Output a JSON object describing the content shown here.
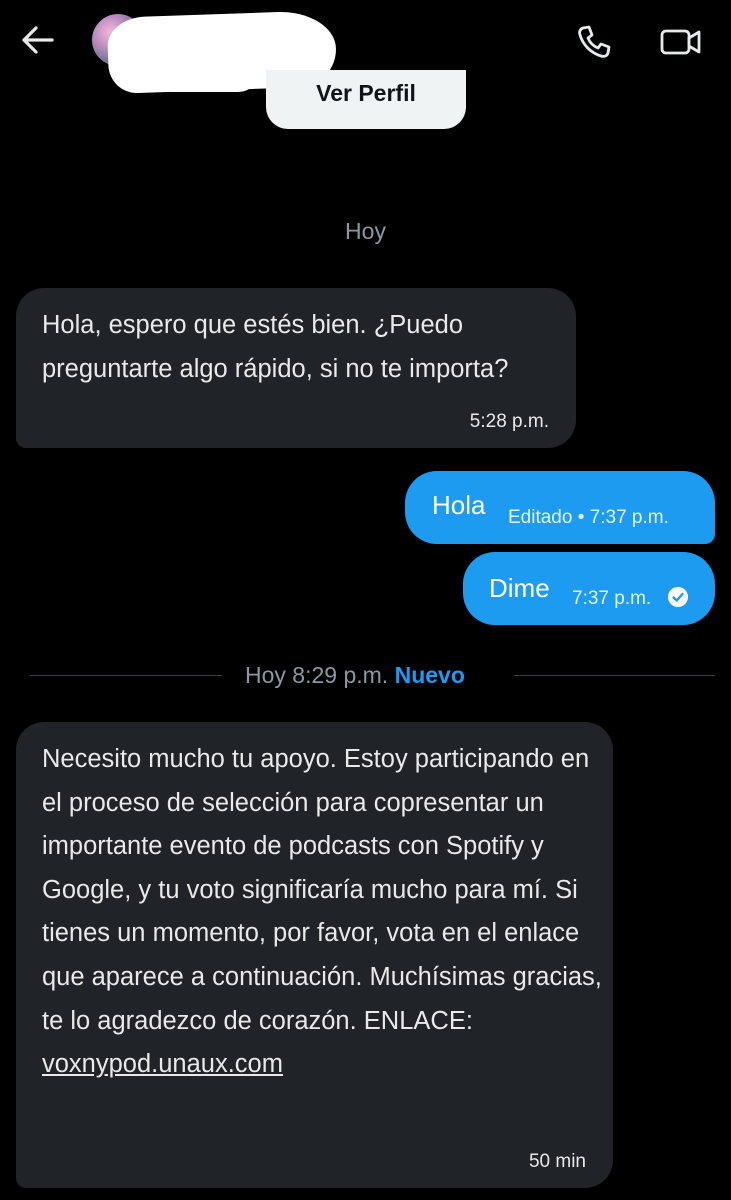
{
  "header": {
    "back_icon": "arrow-left-icon",
    "call_icon": "phone-icon",
    "video_icon": "video-camera-icon",
    "view_profile_label": "Ver Perfil"
  },
  "date_separator": "Hoy",
  "messages": [
    {
      "direction": "incoming",
      "text": "Hola, espero que estés bien. ¿Puedo preguntarte algo rápido, si no te importa?",
      "time": "5:28 p.m."
    },
    {
      "direction": "outgoing",
      "text": "Hola",
      "meta": "Editado • 7:37 p.m."
    },
    {
      "direction": "outgoing",
      "text": "Dime",
      "meta": "7:37 p.m.",
      "status_icon": "check-circle-icon"
    }
  ],
  "new_divider": {
    "label": "Hoy 8:29 p.m.",
    "new_label": "Nuevo"
  },
  "last_message": {
    "direction": "incoming",
    "text": "Necesito mucho tu apoyo. Estoy participando en el proceso de selección para copresentar un importante evento de podcasts con Spotify y Google, y tu voto significaría mucho para mí. Si tienes un momento, por favor, vota en el enlace que aparece a continuación. Muchísimas gracias, te lo agradezco de corazón. ENLACE:",
    "link": "voxnypod.unaux.com",
    "time": "50 min"
  },
  "colors": {
    "background": "#000000",
    "incoming_bubble": "#202327",
    "outgoing_bubble": "#1d9bf0",
    "accent": "#1d9bf0",
    "muted_text": "#8b98a5"
  }
}
